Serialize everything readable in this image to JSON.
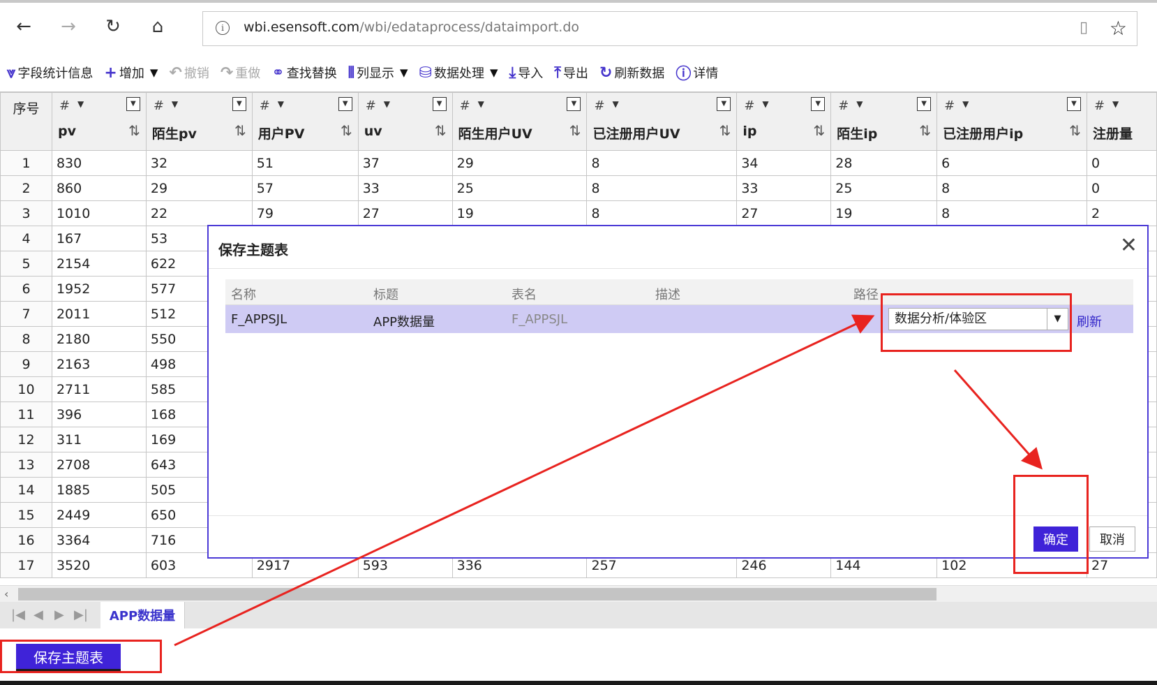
{
  "browser": {
    "url_host": "wbi.esensoft.com",
    "url_path": "/wbi/edataprocess/dataimport.do"
  },
  "toolbar": {
    "items": [
      {
        "icon": "chevrons-down-icon",
        "label": "字段统计信息",
        "disabled": false
      },
      {
        "icon": "plus-icon",
        "label": "增加",
        "disabled": false,
        "dropdown": true
      },
      {
        "icon": "undo-icon",
        "label": "撤销",
        "disabled": true
      },
      {
        "icon": "redo-icon",
        "label": "重做",
        "disabled": true
      },
      {
        "icon": "binoculars-icon",
        "label": "查找替换",
        "disabled": false
      },
      {
        "icon": "columns-icon",
        "label": "列显示",
        "disabled": false,
        "dropdown": true
      },
      {
        "icon": "database-icon",
        "label": "数据处理",
        "disabled": false,
        "dropdown": true
      },
      {
        "icon": "import-icon",
        "label": "导入",
        "disabled": false
      },
      {
        "icon": "export-icon",
        "label": "导出",
        "disabled": false
      },
      {
        "icon": "refresh-icon",
        "label": "刷新数据",
        "disabled": false
      },
      {
        "icon": "info-icon",
        "label": "详情",
        "disabled": false
      }
    ]
  },
  "grid": {
    "rownum_header": "序号",
    "type_symbol": "#",
    "columns": [
      "pv",
      "陌生pv",
      "用户PV",
      "uv",
      "陌生用户UV",
      "已注册用户UV",
      "ip",
      "陌生ip",
      "已注册用户ip",
      "注册量"
    ],
    "rows": [
      [
        "1",
        "830",
        "32",
        "51",
        "37",
        "29",
        "8",
        "34",
        "28",
        "6",
        "0"
      ],
      [
        "2",
        "860",
        "29",
        "57",
        "33",
        "25",
        "8",
        "33",
        "25",
        "8",
        "0"
      ],
      [
        "3",
        "1010",
        "22",
        "79",
        "27",
        "19",
        "8",
        "27",
        "19",
        "8",
        "2"
      ],
      [
        "4",
        "167",
        "53",
        "",
        "",
        "",
        "",
        "",
        "",
        "",
        ""
      ],
      [
        "5",
        "2154",
        "622",
        "",
        "",
        "",
        "",
        "",
        "",
        "",
        ""
      ],
      [
        "6",
        "1952",
        "577",
        "",
        "",
        "",
        "",
        "",
        "",
        "",
        ""
      ],
      [
        "7",
        "2011",
        "512",
        "",
        "",
        "",
        "",
        "",
        "",
        "",
        ""
      ],
      [
        "8",
        "2180",
        "550",
        "",
        "",
        "",
        "",
        "",
        "",
        "",
        ""
      ],
      [
        "9",
        "2163",
        "498",
        "",
        "",
        "",
        "",
        "",
        "",
        "",
        ""
      ],
      [
        "10",
        "2711",
        "585",
        "",
        "",
        "",
        "",
        "",
        "",
        "",
        ""
      ],
      [
        "11",
        "396",
        "168",
        "",
        "",
        "",
        "",
        "",
        "",
        "",
        ""
      ],
      [
        "12",
        "311",
        "169",
        "",
        "",
        "",
        "",
        "",
        "",
        "",
        ""
      ],
      [
        "13",
        "2708",
        "643",
        "",
        "",
        "",
        "",
        "",
        "",
        "",
        ""
      ],
      [
        "14",
        "1885",
        "505",
        "",
        "",
        "",
        "",
        "",
        "",
        "",
        ""
      ],
      [
        "15",
        "2449",
        "650",
        "",
        "",
        "",
        "",
        "",
        "",
        "",
        ""
      ],
      [
        "16",
        "3364",
        "716",
        "",
        "",
        "",
        "",
        "",
        "",
        "",
        ""
      ],
      [
        "17",
        "3520",
        "603",
        "2917",
        "593",
        "336",
        "257",
        "246",
        "144",
        "102",
        "27"
      ]
    ]
  },
  "sheet_tab": "APP数据量",
  "save_button": "保存主题表",
  "dialog": {
    "title": "保存主题表",
    "headers": {
      "name": "名称",
      "title": "标题",
      "table": "表名",
      "desc": "描述",
      "path": "路径"
    },
    "row": {
      "name": "F_APPSJL",
      "title": "APP数据量",
      "table": "F_APPSJL",
      "desc": "",
      "path": "数据分析/体验区"
    },
    "refresh_label": "刷新",
    "ok_label": "确定",
    "cancel_label": "取消"
  },
  "colors": {
    "accent": "#3f23d8",
    "annotation": "#e8231f",
    "selected_row": "#cfcbf4"
  }
}
